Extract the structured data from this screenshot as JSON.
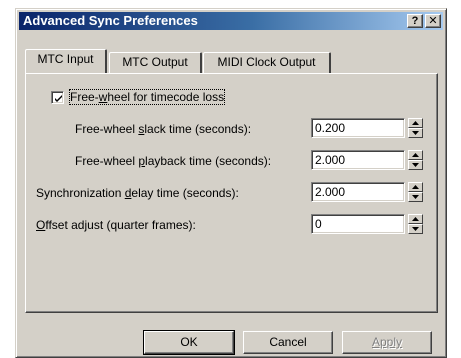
{
  "window": {
    "title": "Advanced Sync Preferences",
    "help_label": "?",
    "close_label": "✕"
  },
  "tabs": [
    {
      "label": "MTC Input",
      "active": true
    },
    {
      "label": "MTC Output",
      "active": false
    },
    {
      "label": "MIDI Clock Output",
      "active": false
    }
  ],
  "mtc_input": {
    "freewheel": {
      "checked": true,
      "label_pre": "Free-",
      "label_ul": "w",
      "label_post": "heel for timecode loss"
    },
    "slack": {
      "label_pre": "Free-wheel ",
      "label_ul": "s",
      "label_post": "lack time (seconds):",
      "value": "0.200"
    },
    "playback": {
      "label_pre": "Free-wheel ",
      "label_ul": "p",
      "label_post": "layback time (seconds):",
      "value": "2.000"
    },
    "sync_delay": {
      "label_pre": "Synchronization ",
      "label_ul": "d",
      "label_post": "elay time (seconds):",
      "value": "2.000"
    },
    "offset": {
      "label_pre": "",
      "label_ul": "O",
      "label_post": "ffset adjust (quarter frames):",
      "value": "0"
    }
  },
  "buttons": {
    "ok": "OK",
    "cancel": "Cancel",
    "apply": "Apply"
  }
}
